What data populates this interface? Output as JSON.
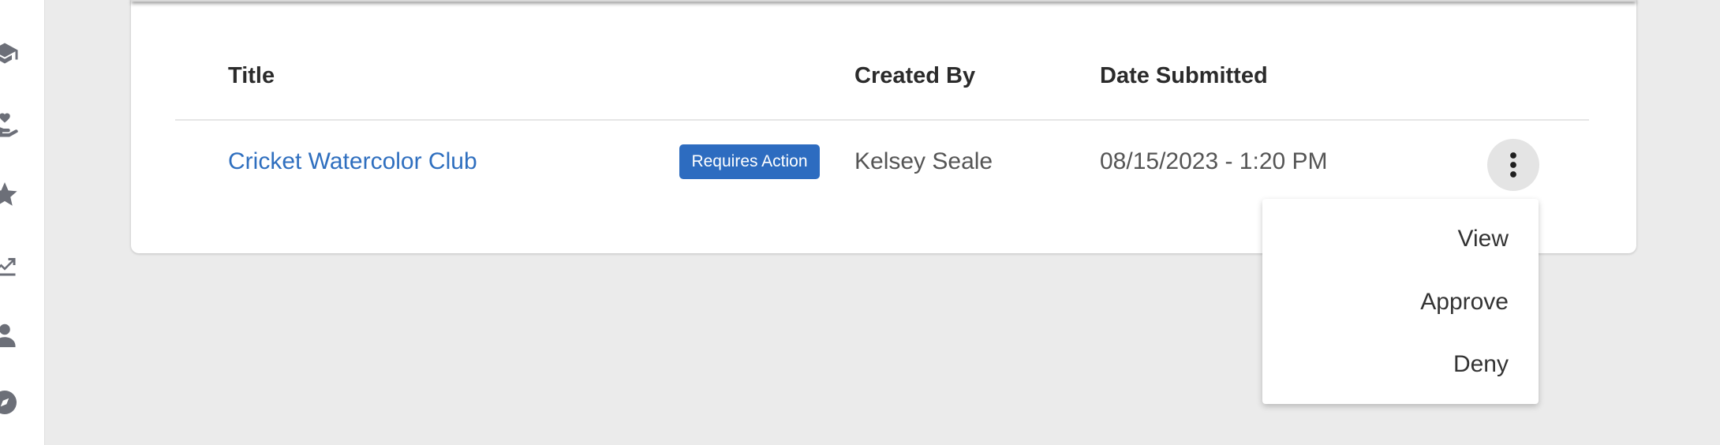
{
  "sidebar": {
    "icons": [
      "graduation-cap-icon",
      "hand-heart-icon",
      "star-icon",
      "chart-trend-icon",
      "person-icon",
      "compass-icon"
    ]
  },
  "table": {
    "headers": {
      "title": "Title",
      "created_by": "Created By",
      "date_submitted": "Date Submitted"
    },
    "rows": [
      {
        "title": "Cricket Watercolor Club",
        "status": "Requires Action",
        "created_by": "Kelsey Seale",
        "date_submitted": "08/15/2023 - 1:20 PM"
      }
    ]
  },
  "menu": {
    "items": [
      "View",
      "Approve",
      "Deny"
    ]
  },
  "colors": {
    "link": "#2f6fbf",
    "badge": "#2d6cc0",
    "background": "#ebebeb"
  }
}
